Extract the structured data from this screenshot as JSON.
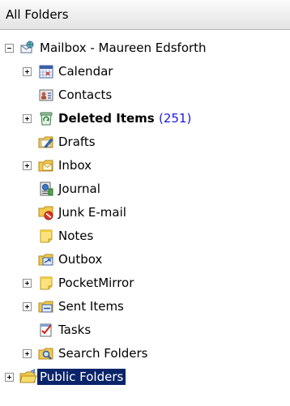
{
  "header": {
    "title": "All Folders"
  },
  "mailbox": {
    "label": "Mailbox - Maureen Edsforth",
    "icon": "mailbox-icon"
  },
  "folders": [
    {
      "id": "calendar",
      "label": "Calendar",
      "icon": "calendar-icon",
      "expander": true
    },
    {
      "id": "contacts",
      "label": "Contacts",
      "icon": "contacts-icon",
      "expander": false
    },
    {
      "id": "deleted-items",
      "label": "Deleted Items",
      "count": "(251)",
      "icon": "recycle-icon",
      "expander": true,
      "bold": true
    },
    {
      "id": "drafts",
      "label": "Drafts",
      "icon": "drafts-icon",
      "expander": false
    },
    {
      "id": "inbox",
      "label": "Inbox",
      "icon": "inbox-icon",
      "expander": true
    },
    {
      "id": "journal",
      "label": "Journal",
      "icon": "journal-icon",
      "expander": false
    },
    {
      "id": "junk-email",
      "label": "Junk E-mail",
      "icon": "junk-icon",
      "expander": false
    },
    {
      "id": "notes",
      "label": "Notes",
      "icon": "notes-icon",
      "expander": false
    },
    {
      "id": "outbox",
      "label": "Outbox",
      "icon": "outbox-icon",
      "expander": false
    },
    {
      "id": "pocketmirror",
      "label": "PocketMirror",
      "icon": "note-folder-icon",
      "expander": true
    },
    {
      "id": "sent-items",
      "label": "Sent Items",
      "icon": "sent-items-icon",
      "expander": true
    },
    {
      "id": "tasks",
      "label": "Tasks",
      "icon": "tasks-icon",
      "expander": false
    },
    {
      "id": "search-folders",
      "label": "Search Folders",
      "icon": "search-folder-icon",
      "expander": true
    }
  ],
  "public_folders": {
    "label": "Public Folders",
    "icon": "public-folder-icon"
  },
  "colors": {
    "selection": "#0a246a",
    "unread_count": "#1a1ae0",
    "folder_yellow": "#f2c94c"
  }
}
